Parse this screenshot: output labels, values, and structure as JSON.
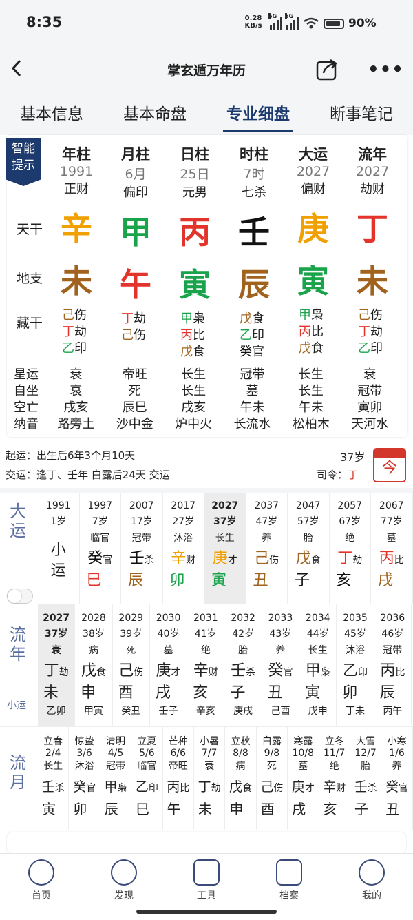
{
  "status": {
    "time": "8:35",
    "speed": "0.28",
    "speed_unit": "KB/s",
    "net1": "5G",
    "net2": "5G",
    "battery": "90%"
  },
  "header": {
    "title": "掌玄遁万年历"
  },
  "tabs": [
    "基本信息",
    "基本命盘",
    "专业细盘",
    "断事笔记"
  ],
  "badge": "智能提示",
  "pillars": [
    {
      "head": "年柱",
      "year": "1991",
      "shishen": "正财",
      "gan": "辛",
      "gan_color": "#f0a000",
      "zhi": "未",
      "zhi_color": "#a0621c",
      "cang": [
        [
          "己",
          "伤",
          "#a0621c"
        ],
        [
          "丁",
          "劫",
          "#e2342b"
        ],
        [
          "乙",
          "印",
          "#19a34a"
        ]
      ]
    },
    {
      "head": "月柱",
      "year": "6月",
      "shishen": "偏印",
      "gan": "甲",
      "gan_color": "#19a34a",
      "zhi": "午",
      "zhi_color": "#e2342b",
      "cang": [
        [
          "丁",
          "劫",
          "#e2342b"
        ],
        [
          "己",
          "伤",
          "#a0621c"
        ]
      ]
    },
    {
      "head": "日柱",
      "year": "25日",
      "shishen": "元男",
      "gan": "丙",
      "gan_color": "#e2342b",
      "zhi": "寅",
      "zhi_color": "#19a34a",
      "cang": [
        [
          "甲",
          "枭",
          "#19a34a"
        ],
        [
          "丙",
          "比",
          "#e2342b"
        ],
        [
          "戊",
          "食",
          "#a0621c"
        ]
      ]
    },
    {
      "head": "时柱",
      "year": "7时",
      "shishen": "七杀",
      "gan": "壬",
      "gan_color": "#111111",
      "zhi": "辰",
      "zhi_color": "#a0621c",
      "cang": [
        [
          "戊",
          "食",
          "#a0621c"
        ],
        [
          "乙",
          "印",
          "#19a34a"
        ],
        [
          "癸",
          "官",
          "#111111"
        ]
      ]
    },
    {
      "head": "大运",
      "year": "2027",
      "shishen": "偏财",
      "gan": "庚",
      "gan_color": "#f0a000",
      "zhi": "寅",
      "zhi_color": "#19a34a",
      "cang": [
        [
          "甲",
          "枭",
          "#19a34a"
        ],
        [
          "丙",
          "比",
          "#e2342b"
        ],
        [
          "戊",
          "食",
          "#a0621c"
        ]
      ]
    },
    {
      "head": "流年",
      "year": "2027",
      "shishen": "劫财",
      "gan": "丁",
      "gan_color": "#e2342b",
      "zhi": "未",
      "zhi_color": "#a0621c",
      "cang": [
        [
          "己",
          "伤",
          "#a0621c"
        ],
        [
          "丁",
          "劫",
          "#e2342b"
        ],
        [
          "乙",
          "印",
          "#19a34a"
        ]
      ]
    }
  ],
  "row_labels": {
    "tiangan": "天干",
    "dizhi": "地支",
    "canggan": "藏干"
  },
  "stats": [
    {
      "label": "星运",
      "vals": [
        "衰",
        "帝旺",
        "长生",
        "冠带",
        "长生",
        "衰"
      ]
    },
    {
      "label": "自坐",
      "vals": [
        "衰",
        "死",
        "长生",
        "墓",
        "长生",
        "冠带"
      ]
    },
    {
      "label": "空亡",
      "vals": [
        "戌亥",
        "辰巳",
        "戌亥",
        "午未",
        "午未",
        "寅卯"
      ]
    },
    {
      "label": "纳音",
      "vals": [
        "路旁土",
        "沙中金",
        "炉中火",
        "长流水",
        "松柏木",
        "天河水"
      ]
    }
  ],
  "info": {
    "qiyun": "起运：出生后6年3个月10天",
    "jiaoyun": "交运：逢丁、壬年 白露后24天 交运",
    "age": "37岁",
    "siling_label": "司令：",
    "siling_val": "丁",
    "cal_icon": "今"
  },
  "dayun": {
    "head": "大运",
    "xiaoyun": "小运",
    "items": [
      {
        "y": "1991",
        "a": "1岁",
        "s": "",
        "g": "",
        "gs": "",
        "gc": "",
        "z": "",
        "zc": ""
      },
      {
        "y": "1997",
        "a": "7岁",
        "s": "临官",
        "g": "癸",
        "gs": "官",
        "gc": "#111111",
        "z": "巳",
        "zc": "#e2342b"
      },
      {
        "y": "2007",
        "a": "17岁",
        "s": "冠带",
        "g": "壬",
        "gs": "杀",
        "gc": "#111111",
        "z": "辰",
        "zc": "#a0621c"
      },
      {
        "y": "2017",
        "a": "27岁",
        "s": "沐浴",
        "g": "辛",
        "gs": "财",
        "gc": "#f0a000",
        "z": "卯",
        "zc": "#19a34a"
      },
      {
        "y": "2027",
        "a": "37岁",
        "s": "长生",
        "g": "庚",
        "gs": "才",
        "gc": "#f0a000",
        "z": "寅",
        "zc": "#19a34a"
      },
      {
        "y": "2037",
        "a": "47岁",
        "s": "养",
        "g": "己",
        "gs": "伤",
        "gc": "#a0621c",
        "z": "丑",
        "zc": "#a0621c"
      },
      {
        "y": "2047",
        "a": "57岁",
        "s": "胎",
        "g": "戊",
        "gs": "食",
        "gc": "#a0621c",
        "z": "子",
        "zc": "#111111"
      },
      {
        "y": "2057",
        "a": "67岁",
        "s": "绝",
        "g": "丁",
        "gs": "劫",
        "gc": "#e2342b",
        "z": "亥",
        "zc": "#111111"
      },
      {
        "y": "2067",
        "a": "77岁",
        "s": "墓",
        "g": "丙",
        "gs": "比",
        "gc": "#e2342b",
        "z": "戌",
        "zc": "#a0621c"
      }
    ]
  },
  "liunian": {
    "head": "流年",
    "xiaoyun": "小运",
    "items": [
      {
        "y": "2027",
        "a": "37岁",
        "s": "衰",
        "g": "丁",
        "gs": "劫",
        "z": "未",
        "xy": "乙卯"
      },
      {
        "y": "2028",
        "a": "38岁",
        "s": "病",
        "g": "戊",
        "gs": "食",
        "z": "申",
        "xy": "甲寅"
      },
      {
        "y": "2029",
        "a": "39岁",
        "s": "死",
        "g": "己",
        "gs": "伤",
        "z": "酉",
        "xy": "癸丑"
      },
      {
        "y": "2030",
        "a": "40岁",
        "s": "墓",
        "g": "庚",
        "gs": "才",
        "z": "戌",
        "xy": "壬子"
      },
      {
        "y": "2031",
        "a": "41岁",
        "s": "绝",
        "g": "辛",
        "gs": "财",
        "z": "亥",
        "xy": "辛亥"
      },
      {
        "y": "2032",
        "a": "42岁",
        "s": "胎",
        "g": "壬",
        "gs": "杀",
        "z": "子",
        "xy": "庚戌"
      },
      {
        "y": "2033",
        "a": "43岁",
        "s": "养",
        "g": "癸",
        "gs": "官",
        "z": "丑",
        "xy": "己酉"
      },
      {
        "y": "2034",
        "a": "44岁",
        "s": "长生",
        "g": "甲",
        "gs": "枭",
        "z": "寅",
        "xy": "戊申"
      },
      {
        "y": "2035",
        "a": "45岁",
        "s": "沐浴",
        "g": "乙",
        "gs": "印",
        "z": "卯",
        "xy": "丁未"
      },
      {
        "y": "2036",
        "a": "46岁",
        "s": "冠带",
        "g": "丙",
        "gs": "比",
        "z": "辰",
        "xy": "丙午"
      }
    ]
  },
  "liuyue": {
    "head": "流月",
    "items": [
      {
        "j": "立春",
        "d": "2/4",
        "s": "长生",
        "g": "壬",
        "gs": "杀",
        "z": "寅"
      },
      {
        "j": "惊蛰",
        "d": "3/6",
        "s": "沐浴",
        "g": "癸",
        "gs": "官",
        "z": "卯"
      },
      {
        "j": "清明",
        "d": "4/5",
        "s": "冠带",
        "g": "甲",
        "gs": "枭",
        "z": "辰"
      },
      {
        "j": "立夏",
        "d": "5/6",
        "s": "临官",
        "g": "乙",
        "gs": "印",
        "z": "巳"
      },
      {
        "j": "芒种",
        "d": "6/6",
        "s": "帝旺",
        "g": "丙",
        "gs": "比",
        "z": "午"
      },
      {
        "j": "小暑",
        "d": "7/7",
        "s": "衰",
        "g": "丁",
        "gs": "劫",
        "z": "未"
      },
      {
        "j": "立秋",
        "d": "8/8",
        "s": "病",
        "g": "戊",
        "gs": "食",
        "z": "申"
      },
      {
        "j": "白露",
        "d": "9/8",
        "s": "死",
        "g": "己",
        "gs": "伤",
        "z": "酉"
      },
      {
        "j": "寒露",
        "d": "10/8",
        "s": "墓",
        "g": "庚",
        "gs": "才",
        "z": "戌"
      },
      {
        "j": "立冬",
        "d": "11/7",
        "s": "绝",
        "g": "辛",
        "gs": "财",
        "z": "亥"
      },
      {
        "j": "大雪",
        "d": "12/7",
        "s": "胎",
        "g": "壬",
        "gs": "杀",
        "z": "子"
      },
      {
        "j": "小寒",
        "d": "1/6",
        "s": "养",
        "g": "癸",
        "gs": "官",
        "z": "丑"
      }
    ]
  },
  "bottom_nav": [
    "首页",
    "发现",
    "工具",
    "档案",
    "我的"
  ]
}
